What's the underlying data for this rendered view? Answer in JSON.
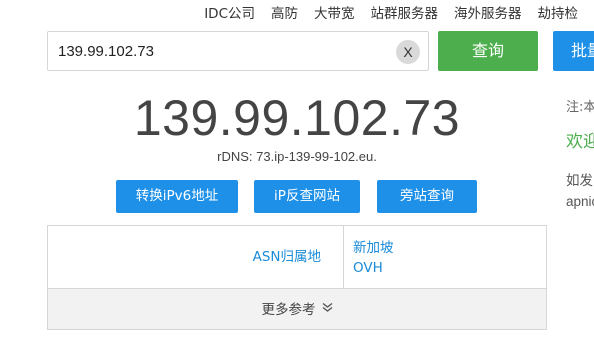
{
  "topnav": {
    "items": [
      "IDC公司",
      "高防",
      "大带宽",
      "站群服务器",
      "海外服务器",
      "劫持检"
    ]
  },
  "search": {
    "value": "139.99.102.73",
    "clear_label": "X",
    "query_label": "查询",
    "batch_label": "批量"
  },
  "result": {
    "ip": "139.99.102.73",
    "rdns": "rDNS: 73.ip-139-99-102.eu."
  },
  "actions": {
    "ipv6_label": "转换iPv6地址",
    "reverse_label": "iP反查网站",
    "sibling_label": "旁站查询"
  },
  "info": {
    "asn_label": "ASN归属地",
    "values": [
      "新加坡",
      "OVH"
    ],
    "more_label": "更多参考",
    "more_icon": "double-chevron-down-icon"
  },
  "sidebar": {
    "note": "注:本",
    "welcome": "欢迎",
    "line1": "如发",
    "line2": "apnic"
  },
  "colors": {
    "green": "#4cae4c",
    "blue": "#1e90e8",
    "link": "#1a8bd8"
  }
}
